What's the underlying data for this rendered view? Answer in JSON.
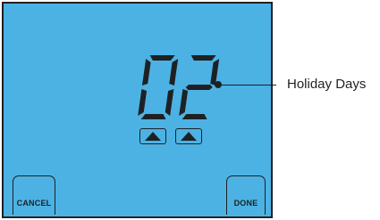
{
  "display": {
    "value": "02",
    "increment_icon": "up-triangle-icon"
  },
  "buttons": {
    "cancel": "CANCEL",
    "done": "DONE"
  },
  "callout": {
    "label": "Holiday Days"
  },
  "colors": {
    "screen_background": "#4cb2e4",
    "foreground": "#1e2124"
  }
}
